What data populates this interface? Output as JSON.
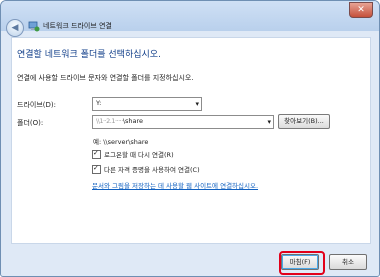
{
  "window": {
    "title": "네트워크 드라이브 연결",
    "close_label": "✕"
  },
  "page": {
    "heading": "연결할 네트워크 폴더를 선택하십시오.",
    "description": "연결에 사용할 드라이브 문자와 연결할 폴더를 지정하십시오."
  },
  "fields": {
    "drive_label": "드라이브(D):",
    "drive_value": "Y:",
    "folder_label": "폴더(O):",
    "folder_value_masked": "\\\\1··2.1·····",
    "folder_value_suffix": "\\share",
    "browse_label": "찾아보기(B)...",
    "example": "예: \\\\server\\share"
  },
  "options": {
    "reconnect_label": "로그온할 때 다시 연결(R)",
    "reconnect_checked": true,
    "other_creds_label": "다른 자격 증명을 사용하여 연결(C)",
    "other_creds_checked": true,
    "link_text": "문서와 그림을 저장하는 데 사용할 웹 사이트에 연결하십시오."
  },
  "buttons": {
    "finish": "마침(F)",
    "cancel": "취소"
  },
  "colors": {
    "heading": "#123f8a",
    "link": "#1060c0",
    "highlight": "#e2001a"
  }
}
